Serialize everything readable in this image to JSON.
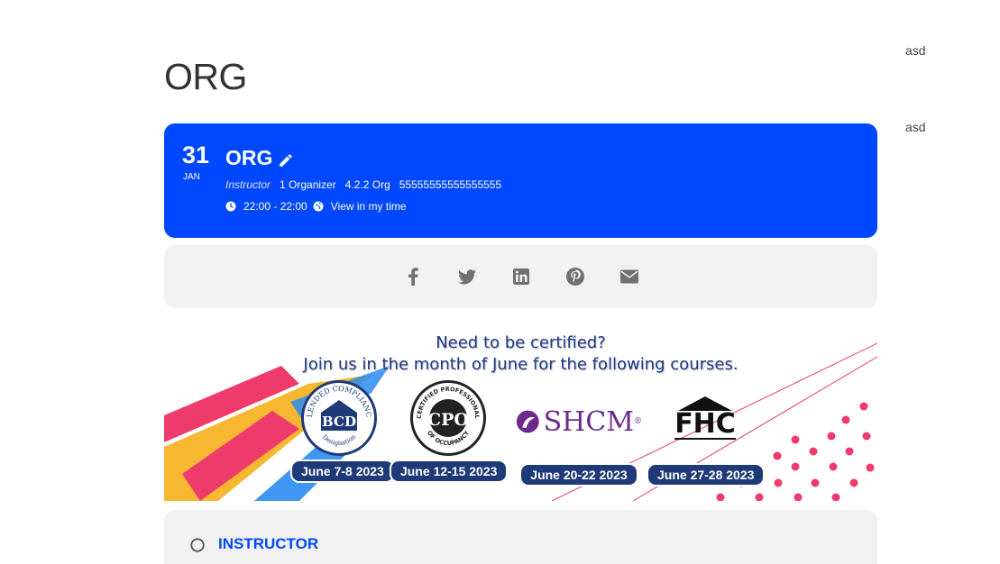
{
  "page": {
    "title": "ORG"
  },
  "sidebar": {
    "items": [
      "asd",
      "asd"
    ]
  },
  "event": {
    "date_day": "31",
    "date_month": "JAN",
    "title": "ORG",
    "instructor_label": "Instructor",
    "instructor_name": "1 Organizer",
    "org": "4.2.2 Org",
    "code": "55555555555555555",
    "time": "22:00 - 22:00",
    "timezone_link": "View in my time"
  },
  "share": {
    "icons": [
      "facebook-icon",
      "twitter-icon",
      "linkedin-icon",
      "pinterest-icon",
      "email-icon"
    ],
    "icon_color": "#707070"
  },
  "banner": {
    "line1": "Need to be certified?",
    "line2": "Join us in the month of June for the following courses.",
    "courses": [
      {
        "logo": "BCD",
        "logo_ring_top": "BLENDED COMPLIANCE",
        "logo_ring_bottom": "Designation",
        "date": "June 7-8 2023"
      },
      {
        "logo": "CPO",
        "logo_ring_top": "CERTIFIED PROFESSIONAL",
        "logo_ring_bottom": "OF OCCUPANCY",
        "date": "June 12-15 2023"
      },
      {
        "logo": "SHCM",
        "logo_mark": "®",
        "date": "June 20-22 2023"
      },
      {
        "logo": "FHC",
        "date": "June 27-28 2023"
      }
    ],
    "colors": {
      "navy": "#1e3a78",
      "accent_pink": "#ef3b6b",
      "accent_yellow": "#f7b731",
      "accent_blue": "#2a8bf2"
    }
  },
  "instructor_section": {
    "heading": "INSTRUCTOR"
  },
  "colors": {
    "primary": "#0048ff",
    "card_bg": "#f1f1f1"
  }
}
